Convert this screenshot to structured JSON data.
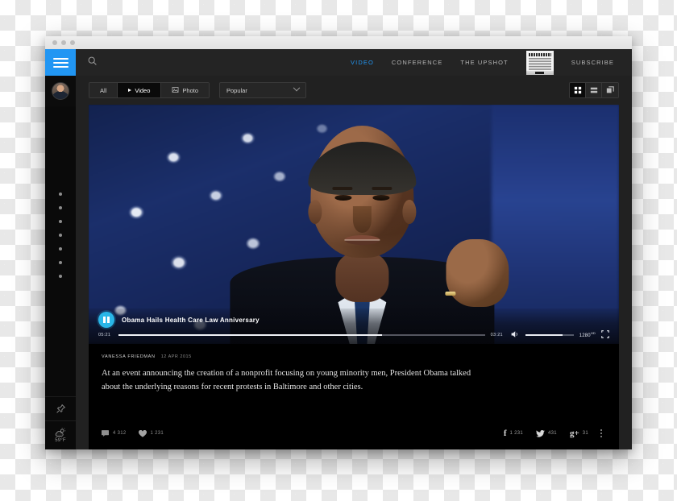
{
  "window": {
    "title_dots": 3
  },
  "sidebar": {
    "menu_icon": "hamburger-icon",
    "avatar_label": "user-avatar",
    "dots_count": 7,
    "pin_icon": "pin-icon",
    "weather_icon": "sun-cloud-icon",
    "temperature": "59°F"
  },
  "topbar": {
    "search_icon": "search-icon",
    "nav": [
      {
        "label": "VIDEO",
        "active": true
      },
      {
        "label": "CONFERENCE",
        "active": false
      },
      {
        "label": "THE UPSHOT",
        "active": false
      },
      {
        "label": "SUBSCRIBE",
        "active": false
      }
    ],
    "paper_thumb": "newspaper-thumbnail"
  },
  "toolbar": {
    "filters": [
      {
        "label": "All",
        "icon": "",
        "active": false
      },
      {
        "label": "Video",
        "icon": "play-icon",
        "active": true
      },
      {
        "label": "Photo",
        "icon": "image-icon",
        "active": false
      }
    ],
    "sort": {
      "value": "Popular",
      "chevron": "chevron-down-icon"
    },
    "views": [
      {
        "icon": "grid-view-icon",
        "active": true
      },
      {
        "icon": "list-view-icon",
        "active": false
      },
      {
        "icon": "card-view-icon",
        "active": false
      }
    ]
  },
  "player": {
    "state_icon": "pause-icon",
    "title": "Obama Hails Health Care Law Anniversary",
    "current_time": "05:21",
    "remaining_time": "03:21",
    "progress_percent": 72,
    "volume_icon": "volume-icon",
    "volume_percent": 78,
    "quality": "1280",
    "quality_sup": "HD",
    "fullscreen_icon": "fullscreen-icon"
  },
  "article": {
    "author": "VANESSA FRIEDMAN",
    "date": "12 APR 2015",
    "description": "At an event announcing the creation of a nonprofit focusing on young minority men, President Obama talked about the underlying reasons for recent protests in Baltimore and other cities.",
    "comments_count": "4 312",
    "likes_count": "1 231",
    "social": [
      {
        "network": "facebook",
        "glyph": "f",
        "count": "1 231"
      },
      {
        "network": "twitter",
        "glyph": "",
        "count": "431"
      },
      {
        "network": "googleplus",
        "glyph": "g+",
        "count": "31"
      }
    ],
    "more_icon": "more-vertical-icon"
  },
  "colors": {
    "accent_blue": "#2196f3",
    "play_cyan": "#29b6e8",
    "app_bg": "#212121",
    "card_bg": "#000000"
  }
}
